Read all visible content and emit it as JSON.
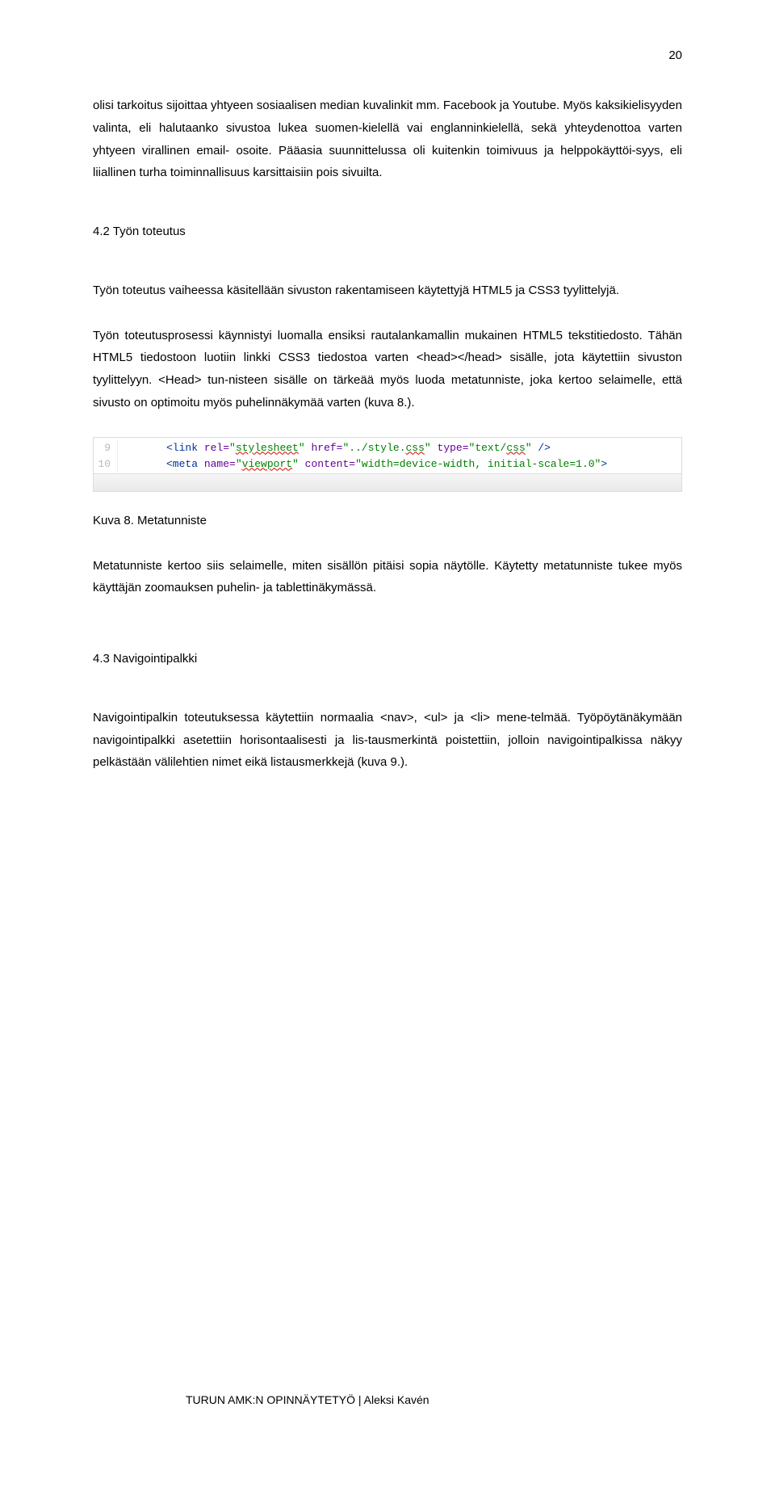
{
  "page": {
    "number": "20"
  },
  "paragraphs": {
    "p1": "olisi tarkoitus sijoittaa yhtyeen sosiaalisen median kuvalinkit mm. Facebook ja Youtube. Myös kaksikielisyyden valinta, eli halutaanko sivustoa lukea suomen-kielellä vai englanninkielellä, sekä yhteydenottoa varten yhtyeen virallinen email- osoite. Pääasia suunnittelussa oli kuitenkin toimivuus ja helppokäyttöi-syys, eli liiallinen turha toiminnallisuus karsittaisiin pois sivuilta.",
    "p2": "Työn toteutus vaiheessa käsitellään sivuston rakentamiseen käytettyjä HTML5 ja CSS3 tyylittelyjä.",
    "p3": "Työn toteutusprosessi käynnistyi luomalla ensiksi rautalankamallin mukainen HTML5 tekstitiedosto. Tähän HTML5 tiedostoon luotiin linkki CSS3 tiedostoa varten <head></head> sisälle, jota käytettiin sivuston tyylittelyyn. <Head> tun-nisteen sisälle on tärkeää myös luoda metatunniste, joka kertoo selaimelle, että sivusto on optimoitu myös puhelinnäkymää varten (kuva 8.).",
    "p4": "Metatunniste kertoo siis selaimelle, miten sisällön pitäisi sopia näytölle. Käytetty metatunniste tukee myös käyttäjän zoomauksen puhelin- ja tablettinäkymässä.",
    "p5": "Navigointipalkin toteutuksessa käytettiin normaalia <nav>, <ul> ja <li> mene-telmää. Työpöytänäkymään navigointipalkki asetettiin horisontaalisesti ja lis-tausmerkintä poistettiin, jolloin navigointipalkissa näkyy pelkästään välilehtien nimet eikä listausmerkkejä (kuva 9.)."
  },
  "headings": {
    "h42": "4.2 Työn toteutus",
    "h43": "4.3 Navigointipalkki"
  },
  "figure": {
    "caption": "Kuva 8. Metatunniste",
    "code": {
      "line9_num": "9",
      "line10_num": "10",
      "l9": {
        "open": "<link",
        "a1": " rel=",
        "v1": "\"",
        "v1txt": "stylesheet",
        "v1c": "\"",
        "a2": " href=",
        "v2": "\"../style.",
        "v2txt": "css",
        "v2c": "\"",
        "a3": " type=",
        "v3": "\"text/",
        "v3txt": "css",
        "v3c": "\"",
        "close": " />"
      },
      "l10": {
        "open": "<meta",
        "a1": " name=",
        "v1": "\"",
        "v1txt": "viewport",
        "v1c": "\"",
        "a2": " content=",
        "v2": "\"width=device-width, initial-scale=1.0\"",
        "close": ">"
      }
    }
  },
  "footer": {
    "text": "TURUN AMK:N OPINNÄYTETYÖ | Aleksi Kavén"
  }
}
